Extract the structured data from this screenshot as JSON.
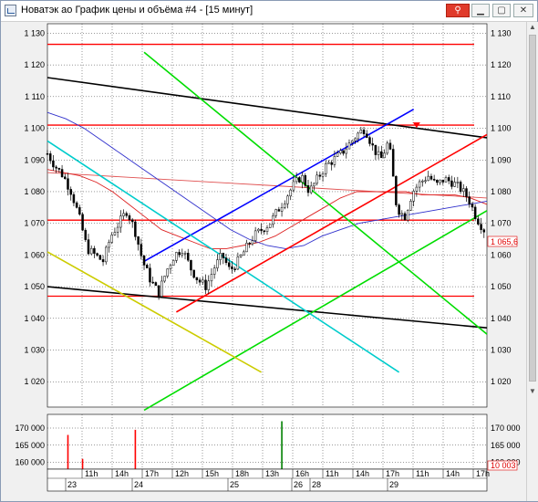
{
  "window": {
    "title": "Новатэк ао График цены и объёма #4 - [15 минут]",
    "pin_icon": "pin-icon",
    "min_icon": "minimize-icon",
    "max_icon": "maximize-icon",
    "close_icon": "close-icon"
  },
  "chart_data": [
    {
      "type": "line",
      "title": "",
      "y_ticks": [
        "1 130",
        "1 120",
        "1 110",
        "1 100",
        "1 090",
        "1 080",
        "1 070",
        "1 060",
        "1 050",
        "1 040",
        "1 030",
        "1 020"
      ],
      "y_values": [
        1130,
        1120,
        1110,
        1100,
        1090,
        1080,
        1070,
        1060,
        1050,
        1040,
        1030,
        1020
      ],
      "ylim": [
        1012,
        1133
      ],
      "last_price_label": "1 065,6",
      "last_price": 1065.6,
      "candles": {
        "x_range": [
          0,
          150
        ],
        "close_path": [
          1092,
          1088,
          1085,
          1080,
          1072,
          1062,
          1060,
          1058,
          1066,
          1070,
          1074,
          1068,
          1058,
          1052,
          1048,
          1055,
          1060,
          1062,
          1056,
          1052,
          1050,
          1056,
          1060,
          1055,
          1058,
          1062,
          1066,
          1068,
          1070,
          1074,
          1078,
          1082,
          1085,
          1080,
          1084,
          1088,
          1090,
          1092,
          1095,
          1098,
          1100,
          1094,
          1090,
          1096,
          1075,
          1072,
          1080,
          1083,
          1085,
          1082,
          1084,
          1083,
          1081,
          1078,
          1072,
          1068
        ]
      },
      "red_ma": [
        1087,
        1086,
        1085,
        1083,
        1080,
        1076,
        1072,
        1068,
        1066,
        1064,
        1062,
        1062,
        1063,
        1064,
        1066,
        1069,
        1072,
        1075,
        1078,
        1080,
        1080,
        1080,
        1080,
        1079,
        1079,
        1079,
        1078,
        1076
      ],
      "blue_ma": [
        1105,
        1103,
        1100,
        1096,
        1092,
        1088,
        1084,
        1080,
        1076,
        1072,
        1068,
        1065,
        1063,
        1062,
        1063,
        1066,
        1068,
        1070,
        1071,
        1072,
        1073,
        1074,
        1075,
        1076,
        1077
      ],
      "red_flat_ma": [
        1086,
        1085,
        1084,
        1083,
        1082,
        1081,
        1080,
        1079,
        1078
      ],
      "channel_lines": [
        {
          "color": "#000000",
          "from": [
            0,
            1116
          ],
          "to": [
            150,
            1097
          ]
        },
        {
          "color": "#000000",
          "from": [
            0,
            1050
          ],
          "to": [
            150,
            1037
          ]
        },
        {
          "color": "#0000ff",
          "from": [
            33,
            1058
          ],
          "to": [
            125,
            1106
          ]
        },
        {
          "color": "#ff0000",
          "from": [
            44,
            1042
          ],
          "to": [
            150,
            1098
          ]
        },
        {
          "color": "#00dd00",
          "from": [
            33,
            1124
          ],
          "to": [
            150,
            1035
          ]
        },
        {
          "color": "#00dd00",
          "from": [
            33,
            1011
          ],
          "to": [
            150,
            1074
          ]
        },
        {
          "color": "#00cccc",
          "from": [
            0,
            1096
          ],
          "to": [
            120,
            1023
          ]
        },
        {
          "color": "#cccc00",
          "from": [
            0,
            1061
          ],
          "to": [
            73,
            1023
          ]
        }
      ],
      "horizontal_levels": [
        {
          "color": "#ff0000",
          "y": 1126.5
        },
        {
          "color": "#ff0000",
          "y": 1101
        },
        {
          "color": "#ff0000",
          "y": 1071
        },
        {
          "color": "#ff0000",
          "y": 1047
        }
      ],
      "marker": {
        "color": "#ff0000",
        "x": 126,
        "y": 1101
      }
    },
    {
      "type": "bar",
      "title": "",
      "y_ticks": [
        "170 000",
        "165 000",
        "160 000"
      ],
      "y_values": [
        170000,
        165000,
        160000
      ],
      "ylim": [
        158000,
        174000
      ],
      "last_volume_label": "10 003",
      "bars": [
        {
          "x": 7,
          "value": 168000,
          "color": "#ff0000"
        },
        {
          "x": 12,
          "value": 161000,
          "color": "#ff0000"
        },
        {
          "x": 30,
          "value": 169500,
          "color": "#ff0000"
        },
        {
          "x": 80,
          "value": 172000,
          "color": "#008000"
        }
      ]
    }
  ],
  "time_axis": {
    "hours": [
      "11h",
      "14h",
      "17h",
      "12h",
      "15h",
      "18h",
      "13h",
      "16h",
      "11h",
      "14h",
      "17h",
      "11h",
      "14h",
      "17h"
    ],
    "days": [
      "23",
      "24",
      "25",
      "26",
      "28",
      "29"
    ]
  }
}
